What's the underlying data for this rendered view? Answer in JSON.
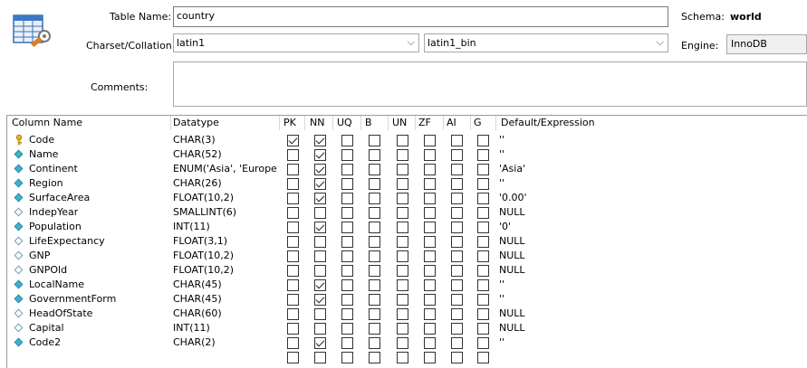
{
  "form": {
    "table_name_label": "Table Name:",
    "table_name_value": "country",
    "schema_label": "Schema:",
    "schema_value": "world",
    "charset_label": "Charset/Collation:",
    "charset_value": "latin1",
    "collation_value": "latin1_bin",
    "engine_label": "Engine:",
    "engine_value": "InnoDB",
    "comments_label": "Comments:",
    "comments_value": ""
  },
  "grid": {
    "headers": {
      "name": "Column Name",
      "datatype": "Datatype",
      "pk": "PK",
      "nn": "NN",
      "uq": "UQ",
      "b": "B",
      "un": "UN",
      "zf": "ZF",
      "ai": "AI",
      "g": "G",
      "default": "Default/Expression"
    },
    "rows": [
      {
        "name": "Code",
        "datatype": "CHAR(3)",
        "icon": "primary-key-icon",
        "flags": [
          1,
          1,
          0,
          0,
          0,
          0,
          0,
          0
        ],
        "default": "''"
      },
      {
        "name": "Name",
        "datatype": "CHAR(52)",
        "icon": "not-null-column-icon",
        "flags": [
          0,
          1,
          0,
          0,
          0,
          0,
          0,
          0
        ],
        "default": "''"
      },
      {
        "name": "Continent",
        "datatype": "ENUM('Asia', 'Europe'...",
        "icon": "not-null-column-icon",
        "flags": [
          0,
          1,
          0,
          0,
          0,
          0,
          0,
          0
        ],
        "default": "'Asia'"
      },
      {
        "name": "Region",
        "datatype": "CHAR(26)",
        "icon": "not-null-column-icon",
        "flags": [
          0,
          1,
          0,
          0,
          0,
          0,
          0,
          0
        ],
        "default": "''"
      },
      {
        "name": "SurfaceArea",
        "datatype": "FLOAT(10,2)",
        "icon": "not-null-column-icon",
        "flags": [
          0,
          1,
          0,
          0,
          0,
          0,
          0,
          0
        ],
        "default": "'0.00'"
      },
      {
        "name": "IndepYear",
        "datatype": "SMALLINT(6)",
        "icon": "nullable-column-icon",
        "flags": [
          0,
          0,
          0,
          0,
          0,
          0,
          0,
          0
        ],
        "default": "NULL"
      },
      {
        "name": "Population",
        "datatype": "INT(11)",
        "icon": "not-null-column-icon",
        "flags": [
          0,
          1,
          0,
          0,
          0,
          0,
          0,
          0
        ],
        "default": "'0'"
      },
      {
        "name": "LifeExpectancy",
        "datatype": "FLOAT(3,1)",
        "icon": "nullable-column-icon",
        "flags": [
          0,
          0,
          0,
          0,
          0,
          0,
          0,
          0
        ],
        "default": "NULL"
      },
      {
        "name": "GNP",
        "datatype": "FLOAT(10,2)",
        "icon": "nullable-column-icon",
        "flags": [
          0,
          0,
          0,
          0,
          0,
          0,
          0,
          0
        ],
        "default": "NULL"
      },
      {
        "name": "GNPOld",
        "datatype": "FLOAT(10,2)",
        "icon": "nullable-column-icon",
        "flags": [
          0,
          0,
          0,
          0,
          0,
          0,
          0,
          0
        ],
        "default": "NULL"
      },
      {
        "name": "LocalName",
        "datatype": "CHAR(45)",
        "icon": "not-null-column-icon",
        "flags": [
          0,
          1,
          0,
          0,
          0,
          0,
          0,
          0
        ],
        "default": "''"
      },
      {
        "name": "GovernmentForm",
        "datatype": "CHAR(45)",
        "icon": "not-null-column-icon",
        "flags": [
          0,
          1,
          0,
          0,
          0,
          0,
          0,
          0
        ],
        "default": "''"
      },
      {
        "name": "HeadOfState",
        "datatype": "CHAR(60)",
        "icon": "nullable-column-icon",
        "flags": [
          0,
          0,
          0,
          0,
          0,
          0,
          0,
          0
        ],
        "default": "NULL"
      },
      {
        "name": "Capital",
        "datatype": "INT(11)",
        "icon": "nullable-column-icon",
        "flags": [
          0,
          0,
          0,
          0,
          0,
          0,
          0,
          0
        ],
        "default": "NULL"
      },
      {
        "name": "Code2",
        "datatype": "CHAR(2)",
        "icon": "not-null-column-icon",
        "flags": [
          0,
          1,
          0,
          0,
          0,
          0,
          0,
          0
        ],
        "default": "''"
      },
      {
        "name": "",
        "datatype": "",
        "icon": "",
        "flags": [
          0,
          0,
          0,
          0,
          0,
          0,
          0,
          0
        ],
        "default": ""
      }
    ]
  },
  "colors": {
    "icon_teal": "#3fb2cf",
    "key_gold": "#e6b422",
    "border": "#a8a8a8"
  }
}
